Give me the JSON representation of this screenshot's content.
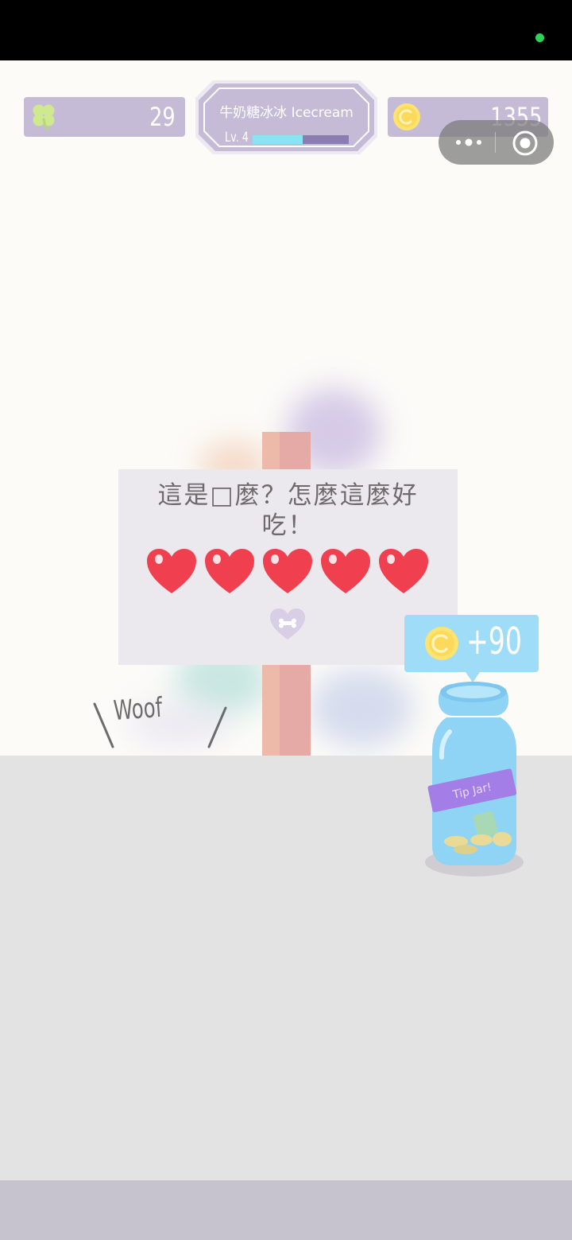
{
  "hud": {
    "clovers": "29",
    "player_name": "牛奶糖冰冰 Icecream",
    "level_label": "Lv. 4",
    "level_progress": 0.52,
    "coins": "1355"
  },
  "sign": {
    "text": "這是□麼？怎麼這麼好吃！",
    "hearts_filled": 5,
    "hearts_total": 5
  },
  "dog_bark": "Woof",
  "tip": {
    "amount": "+90",
    "jar_label": "Tip Jar!"
  },
  "colors": {
    "hud_purple": "#c5bbd7",
    "progress_fill": "#8ae3f3",
    "heart_red": "#f0404f",
    "tip_blue": "#9fdcf8",
    "coin_yellow": "#fde370",
    "floor": "#e4e3e4"
  },
  "icons": {
    "clover": "clover-icon",
    "coin": "coin-icon",
    "menu": "more-dots-icon",
    "close": "target-close-icon",
    "heart": "heart-icon",
    "bone_heart": "bone-heart-icon"
  }
}
